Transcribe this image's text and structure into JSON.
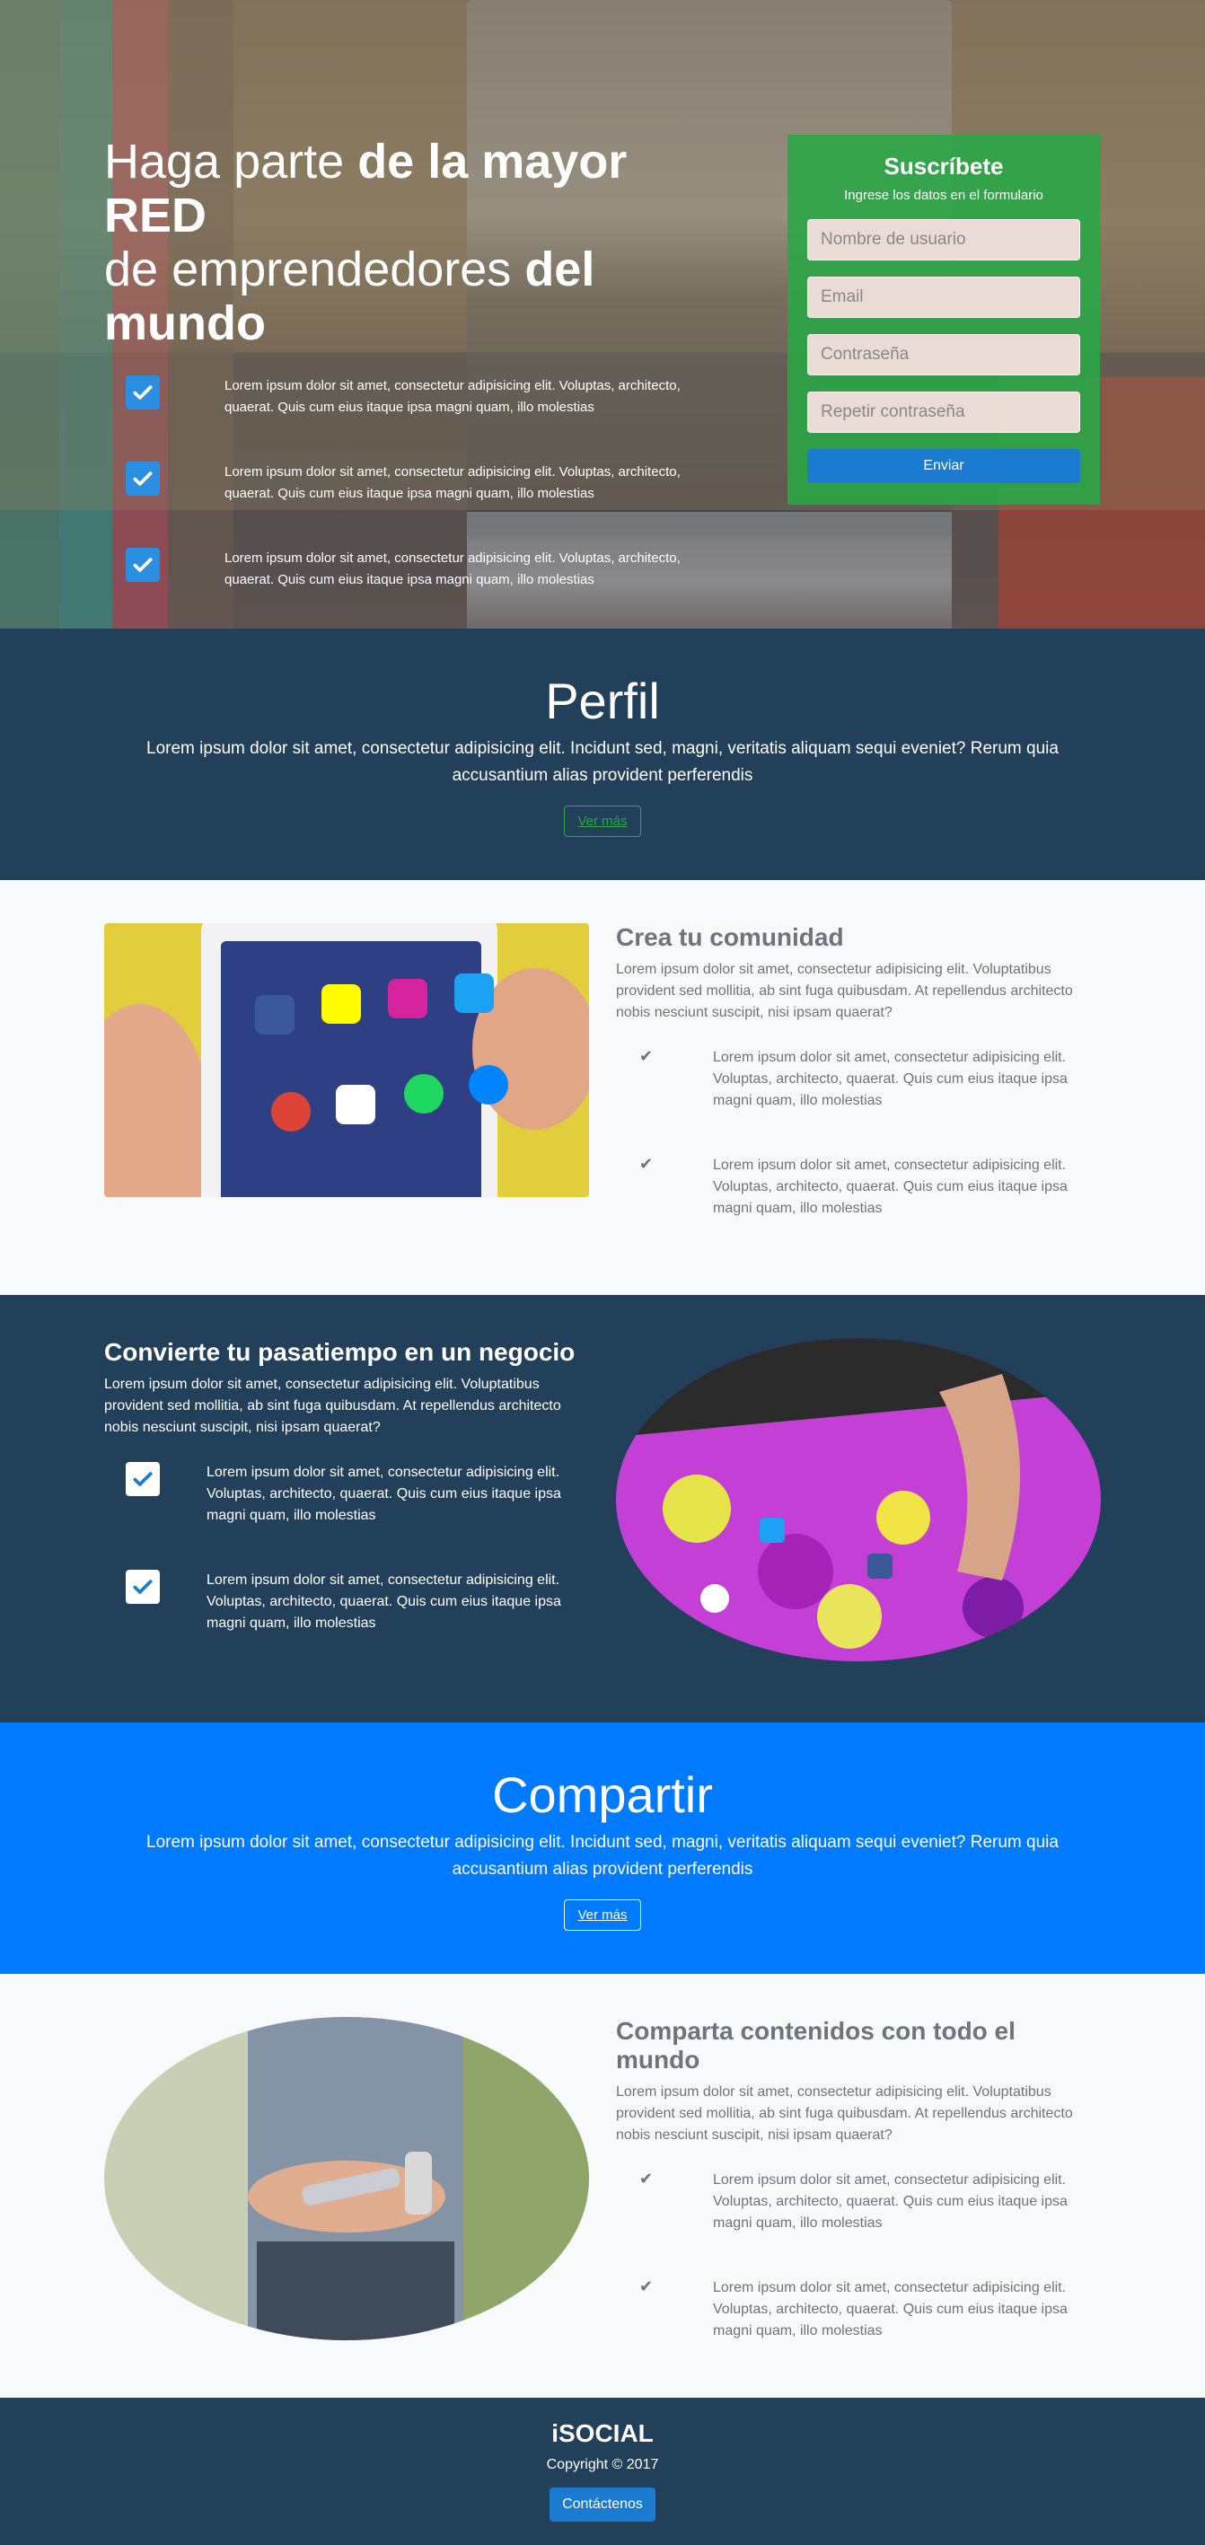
{
  "hero": {
    "title_light_1": "Haga parte ",
    "title_bold_1": "de la mayor RED",
    "title_light_2": "de emprendedores ",
    "title_bold_2": "del mundo",
    "items": [
      "Lorem ipsum dolor sit amet, consectetur adipisicing elit. Voluptas, architecto, quaerat. Quis cum eius itaque ipsa magni quam, illo molestias",
      "Lorem ipsum dolor sit amet, consectetur adipisicing elit. Voluptas, architecto, quaerat. Quis cum eius itaque ipsa magni quam, illo molestias",
      "Lorem ipsum dolor sit amet, consectetur adipisicing elit. Voluptas, architecto, quaerat. Quis cum eius itaque ipsa magni quam, illo molestias"
    ]
  },
  "signup": {
    "title": "Suscríbete",
    "subtitle": "Ingrese los datos en el formulario",
    "username_placeholder": "Nombre de usuario",
    "email_placeholder": "Email",
    "password_placeholder": "Contraseña",
    "repeat_password_placeholder": "Repetir contraseña",
    "submit_label": "Enviar"
  },
  "perfil": {
    "title": "Perfil",
    "text": "Lorem ipsum dolor sit amet, consectetur adipisicing elit. Incidunt sed, magni, veritatis aliquam sequi eveniet? Rerum quia accusantium alias provident perferendis",
    "button": "Ver más"
  },
  "comunidad": {
    "title": "Crea tu comunidad",
    "lead": "Lorem ipsum dolor sit amet, consectetur adipisicing elit. Voluptatibus provident sed mollitia, ab sint fuga quibusdam. At repellendus architecto nobis nesciunt suscipit, nisi ipsam quaerat?",
    "items": [
      "Lorem ipsum dolor sit amet, consectetur adipisicing elit. Voluptas, architecto, quaerat. Quis cum eius itaque ipsa magni quam, illo molestias",
      "Lorem ipsum dolor sit amet, consectetur adipisicing elit. Voluptas, architecto, quaerat. Quis cum eius itaque ipsa magni quam, illo molestias"
    ],
    "apps": [
      "Facebook",
      "Snapchat",
      "Instagram",
      "Twitter",
      "Chrome",
      "Gmail",
      "Spotify",
      "Messenger"
    ]
  },
  "negocio": {
    "title": "Convierte tu pasatiempo en un negocio",
    "lead": "Lorem ipsum dolor sit amet, consectetur adipisicing elit. Voluptatibus provident sed mollitia, ab sint fuga quibusdam. At repellendus architecto nobis nesciunt suscipit, nisi ipsam quaerat?",
    "items": [
      "Lorem ipsum dolor sit amet, consectetur adipisicing elit. Voluptas, architecto, quaerat. Quis cum eius itaque ipsa magni quam, illo molestias",
      "Lorem ipsum dolor sit amet, consectetur adipisicing elit. Voluptas, architecto, quaerat. Quis cum eius itaque ipsa magni quam, illo molestias"
    ]
  },
  "compartir": {
    "title": "Compartir",
    "text": "Lorem ipsum dolor sit amet, consectetur adipisicing elit. Incidunt sed, magni, veritatis aliquam sequi eveniet? Rerum quia accusantium alias provident perferendis",
    "button": "Ver más"
  },
  "contenidos": {
    "title": "Comparta contenidos con todo el mundo",
    "lead": "Lorem ipsum dolor sit amet, consectetur adipisicing elit. Voluptatibus provident sed mollitia, ab sint fuga quibusdam. At repellendus architecto nobis nesciunt suscipit, nisi ipsam quaerat?",
    "items": [
      "Lorem ipsum dolor sit amet, consectetur adipisicing elit. Voluptas, architecto, quaerat. Quis cum eius itaque ipsa magni quam, illo molestias",
      "Lorem ipsum dolor sit amet, consectetur adipisicing elit. Voluptas, architecto, quaerat. Quis cum eius itaque ipsa magni quam, illo molestias"
    ]
  },
  "footer": {
    "brand": "iSOCIAL",
    "copyright": "Copyright © 2017",
    "contact_button": "Contáctenos"
  },
  "colors": {
    "navy": "#22405a",
    "green": "#28a745",
    "blue": "#007bff",
    "button_blue": "#1a7bd0",
    "light_bg": "#f8f9fa",
    "muted_text": "#6c757d"
  }
}
